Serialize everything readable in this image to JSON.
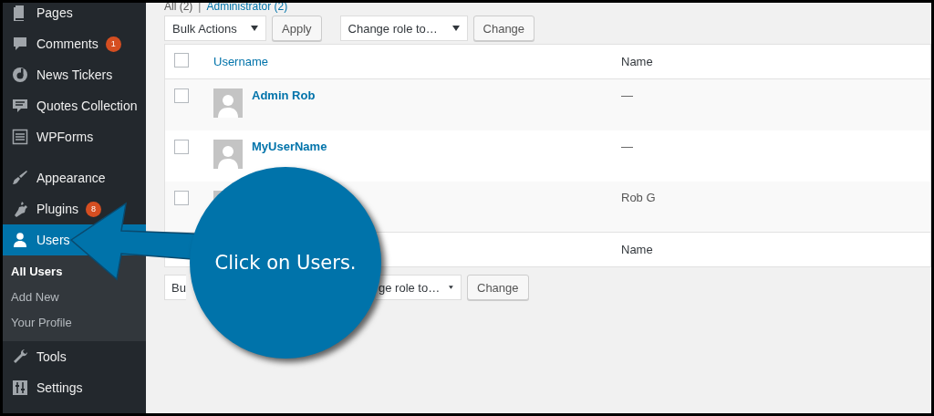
{
  "sidebar": {
    "groups": [
      [
        {
          "label": "Pages",
          "selected": false
        },
        {
          "label": "Comments",
          "badge": "1",
          "selected": false
        },
        {
          "label": "News Tickers",
          "selected": false
        },
        {
          "label": "Quotes Collection",
          "selected": false
        },
        {
          "label": "WPForms",
          "selected": false
        }
      ],
      [
        {
          "label": "Appearance",
          "selected": false
        },
        {
          "label": "Plugins",
          "badge": "8",
          "selected": false
        },
        {
          "label": "Users",
          "selected": true,
          "children": [
            {
              "label": "All Users",
              "selected": true
            },
            {
              "label": "Add New",
              "selected": false
            },
            {
              "label": "Your Profile",
              "selected": false
            }
          ]
        },
        {
          "label": "Tools",
          "selected": false
        },
        {
          "label": "Settings",
          "selected": false
        }
      ]
    ]
  },
  "filters": [
    {
      "label": "All (2)"
    },
    {
      "label": "Administrator (2)"
    }
  ],
  "filter_separator": "|",
  "top_actions": {
    "bulk": "Bulk Actions",
    "apply": "Apply",
    "role": "Change role to…",
    "change": "Change"
  },
  "table": {
    "columns": [
      "Username",
      "Name"
    ],
    "header_checked": false,
    "rows": [
      {
        "checked": false,
        "username": "Admin Rob",
        "name": "—"
      },
      {
        "checked": false,
        "username": "MyUserName",
        "name": "—"
      },
      {
        "checked": false,
        "name": "Rob G"
      }
    ],
    "footer_columns": [
      "Name"
    ]
  },
  "bottom_actions": {
    "bulk": "Bu",
    "role": "ge role to…",
    "change": "Change"
  },
  "callout": {
    "text": "Click on Users."
  }
}
